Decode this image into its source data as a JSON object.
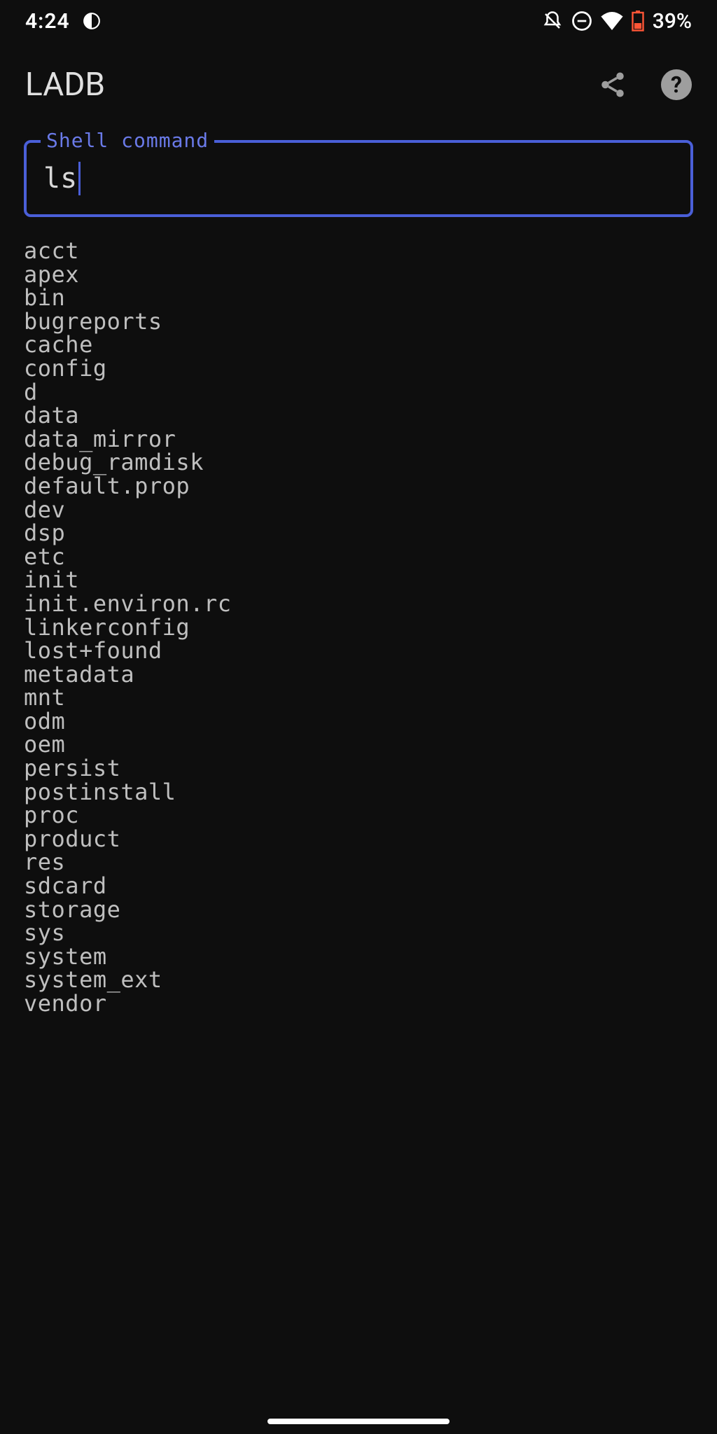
{
  "status_bar": {
    "time": "4:24",
    "battery_percent": "39%",
    "icons": {
      "app_notification": "app-notification-icon",
      "notifications_off": "notifications-off-icon",
      "do_not_disturb": "dnd-icon",
      "wifi": "wifi-icon",
      "battery": "battery-icon"
    }
  },
  "app_bar": {
    "title": "LADB",
    "share_label": "share-icon",
    "help_label": "?"
  },
  "shell_input": {
    "label": "Shell command",
    "value": "ls"
  },
  "output_lines": [
    "acct",
    "apex",
    "bin",
    "bugreports",
    "cache",
    "config",
    "d",
    "data",
    "data_mirror",
    "debug_ramdisk",
    "default.prop",
    "dev",
    "dsp",
    "etc",
    "init",
    "init.environ.rc",
    "linkerconfig",
    "lost+found",
    "metadata",
    "mnt",
    "odm",
    "oem",
    "persist",
    "postinstall",
    "proc",
    "product",
    "res",
    "sdcard",
    "storage",
    "sys",
    "system",
    "system_ext",
    "vendor"
  ]
}
